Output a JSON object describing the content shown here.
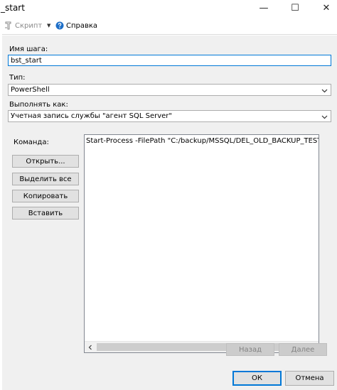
{
  "window": {
    "title": "_start",
    "controls": {
      "minimize": "—",
      "maximize": "☐",
      "close": "✕"
    }
  },
  "toolbar": {
    "script_label": "Скрипт",
    "script_icon": "script-icon",
    "dropdown_arrow": "▼",
    "help_label": "Справка",
    "help_icon": "help-icon"
  },
  "form": {
    "step_name_label": "Имя шага:",
    "step_name_value": "bst_start",
    "type_label": "Тип:",
    "type_value": "PowerShell",
    "run_as_label": "Выполнять как:",
    "run_as_value": "Учетная запись службы \"агент SQL Server\"",
    "command_label": "Команда:",
    "command_text": "Start-Process -FilePath \"C:/backup/MSSQL/DEL_OLD_BACKUP_TEST.bat\" -Ve"
  },
  "command_buttons": {
    "open": "Открыть...",
    "select_all": "Выделить все",
    "copy": "Копировать",
    "paste": "Вставить"
  },
  "nav": {
    "back": "Назад",
    "next": "Далее"
  },
  "dialog": {
    "ok": "ОК",
    "cancel": "Отмена"
  },
  "colors": {
    "accent": "#0078d7",
    "panel": "#f0f0f0",
    "help_icon": "#1e6fc8"
  }
}
